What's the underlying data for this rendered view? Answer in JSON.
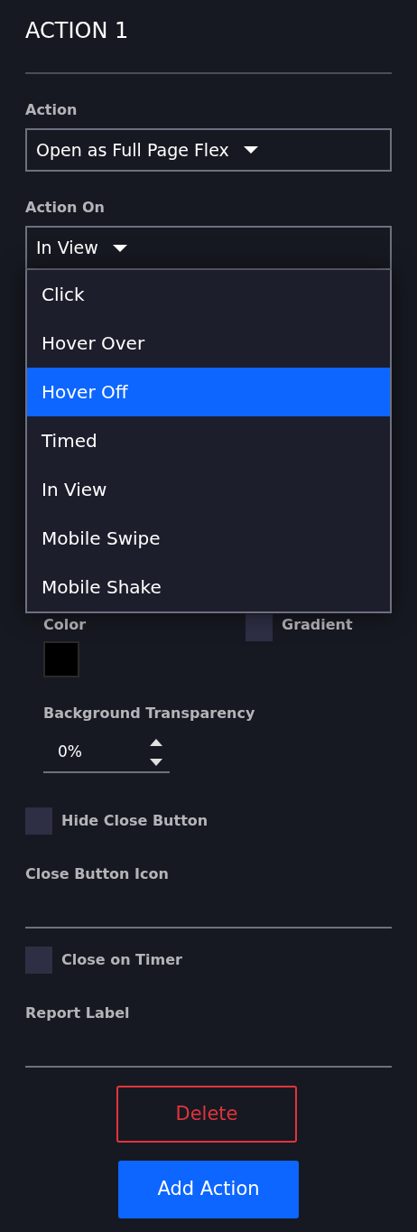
{
  "title": "ACTION 1",
  "action": {
    "label": "Action",
    "value": "Open as Full Page Flex"
  },
  "action_on": {
    "label": "Action On",
    "value": "In View",
    "expanded": true,
    "options": [
      {
        "label": "Click",
        "highlighted": false
      },
      {
        "label": "Hover Over",
        "highlighted": false
      },
      {
        "label": "Hover Off",
        "highlighted": true
      },
      {
        "label": "Timed",
        "highlighted": false
      },
      {
        "label": "In View",
        "highlighted": false
      },
      {
        "label": "Mobile Swipe",
        "highlighted": false
      },
      {
        "label": "Mobile Shake",
        "highlighted": false
      }
    ]
  },
  "color": {
    "label": "Color",
    "color": "#000000"
  },
  "gradient": {
    "label": "Gradient",
    "checked": false
  },
  "background_transparency": {
    "label": "Background Transparency",
    "value": "0%"
  },
  "hide_close_button": {
    "label": "Hide Close Button",
    "checked": false
  },
  "close_button_icon": {
    "label": "Close Button Icon"
  },
  "close_on_timer": {
    "label": "Close on Timer",
    "checked": false
  },
  "report_label": {
    "label": "Report Label"
  },
  "buttons": [
    {
      "label": "Delete",
      "kind": "danger"
    },
    {
      "label": "Add Action",
      "kind": "primary"
    }
  ]
}
